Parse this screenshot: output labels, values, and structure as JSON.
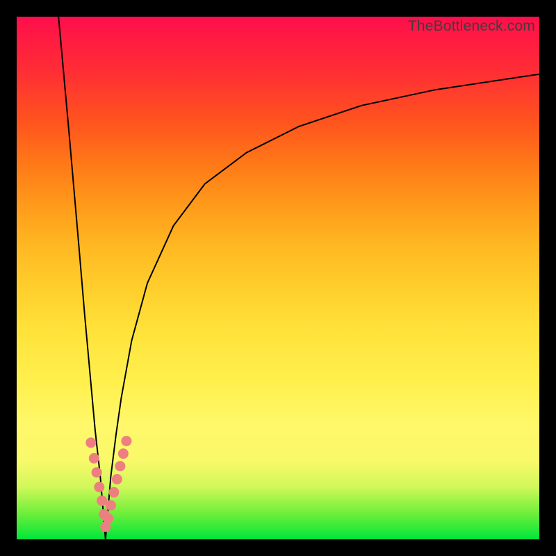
{
  "watermark": "TheBottleneck.com",
  "colors": {
    "frame": "#000000",
    "gradient_top": "#ff0d4c",
    "gradient_bottom": "#00e63b",
    "curve": "#000000",
    "marker": "#ed7f81"
  },
  "chart_data": {
    "type": "line",
    "title": "",
    "xlabel": "",
    "ylabel": "",
    "xlim": [
      0,
      100
    ],
    "ylim": [
      0,
      100
    ],
    "min_x": 17,
    "series": [
      {
        "name": "left-branch",
        "x": [
          8,
          10,
          12,
          13,
          14,
          15,
          16,
          16.5,
          17
        ],
        "y": [
          100,
          78,
          55,
          43,
          32,
          21,
          12,
          6,
          0
        ]
      },
      {
        "name": "right-branch",
        "x": [
          17,
          17.5,
          18,
          19,
          20,
          22,
          25,
          30,
          36,
          44,
          54,
          66,
          80,
          100
        ],
        "y": [
          0,
          6,
          12,
          20,
          27,
          38,
          49,
          60,
          68,
          74,
          79,
          83,
          86,
          89
        ]
      }
    ],
    "markers": {
      "name": "sample-dots",
      "x": [
        14.2,
        14.8,
        15.3,
        15.8,
        16.3,
        16.7,
        17.0,
        17.5,
        18.0,
        18.6,
        19.2,
        19.8,
        20.4,
        21.0
      ],
      "y": [
        18.5,
        15.5,
        12.8,
        10.0,
        7.4,
        4.8,
        2.4,
        4.0,
        6.5,
        9.0,
        11.5,
        14.0,
        16.4,
        18.8
      ]
    }
  }
}
